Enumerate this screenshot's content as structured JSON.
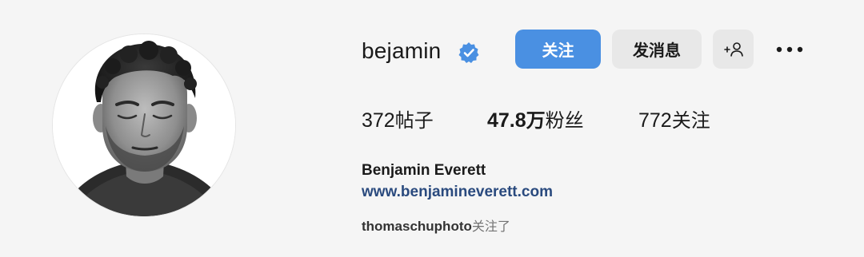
{
  "profile": {
    "username": "bejamin",
    "verified": true,
    "full_name": "Benjamin Everett",
    "website": "www.benjamineverett.com",
    "avatar_icon": "profile-photo"
  },
  "actions": {
    "follow_label": "关注",
    "message_label": "发消息",
    "add_user_icon": "add-user-icon",
    "more_icon": "more-horizontal-icon"
  },
  "stats": {
    "posts": {
      "value": "372",
      "label": "帖子"
    },
    "followers": {
      "value": "47.8",
      "unit": "万",
      "label": "粉丝"
    },
    "following": {
      "value": "772",
      "label": "关注"
    }
  },
  "followed_by": {
    "user": "thomaschuphoto",
    "suffix": "关注了"
  },
  "colors": {
    "background": "#f5f5f5",
    "follow_button": "#4a90e2",
    "secondary_button": "#e8e8e8",
    "verified_badge": "#4a90e2",
    "link": "#2a4a7e"
  }
}
